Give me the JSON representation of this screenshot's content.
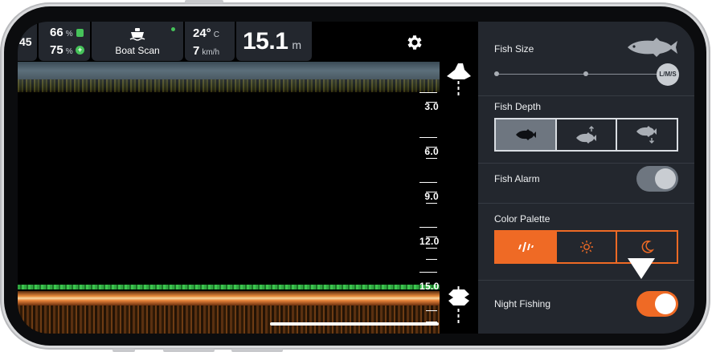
{
  "status": {
    "left_partial": "45",
    "phone_battery": "66",
    "phone_battery_unit": "%",
    "device_battery": "75",
    "device_battery_unit": "%",
    "mode_label": "Boat Scan",
    "temperature": "24°",
    "temperature_unit": "C",
    "speed": "7",
    "speed_unit": "km/h",
    "depth": "15.1",
    "depth_unit": "m"
  },
  "depth_scale": {
    "labels": [
      "3.0",
      "6.0",
      "9.0",
      "12.0",
      "15.0"
    ]
  },
  "settings": {
    "fish_size": {
      "label": "Fish Size",
      "knob_label": "L/M/S",
      "level": 1.0
    },
    "fish_depth": {
      "label": "Fish Depth",
      "options": [
        "fish-icon",
        "fish-depth-up-icon",
        "fish-depth-down-icon"
      ],
      "selected": 0
    },
    "fish_alarm": {
      "label": "Fish Alarm",
      "on": false
    },
    "color_palette": {
      "label": "Color Palette",
      "options": [
        "brand-logo-icon",
        "sun-icon",
        "moon-icon"
      ],
      "selected": 0
    },
    "night_fishing": {
      "label": "Night Fishing",
      "on": true
    }
  },
  "colors": {
    "accent": "#ef6a25",
    "panel": "#23272e",
    "battery_green": "#46c35a"
  }
}
